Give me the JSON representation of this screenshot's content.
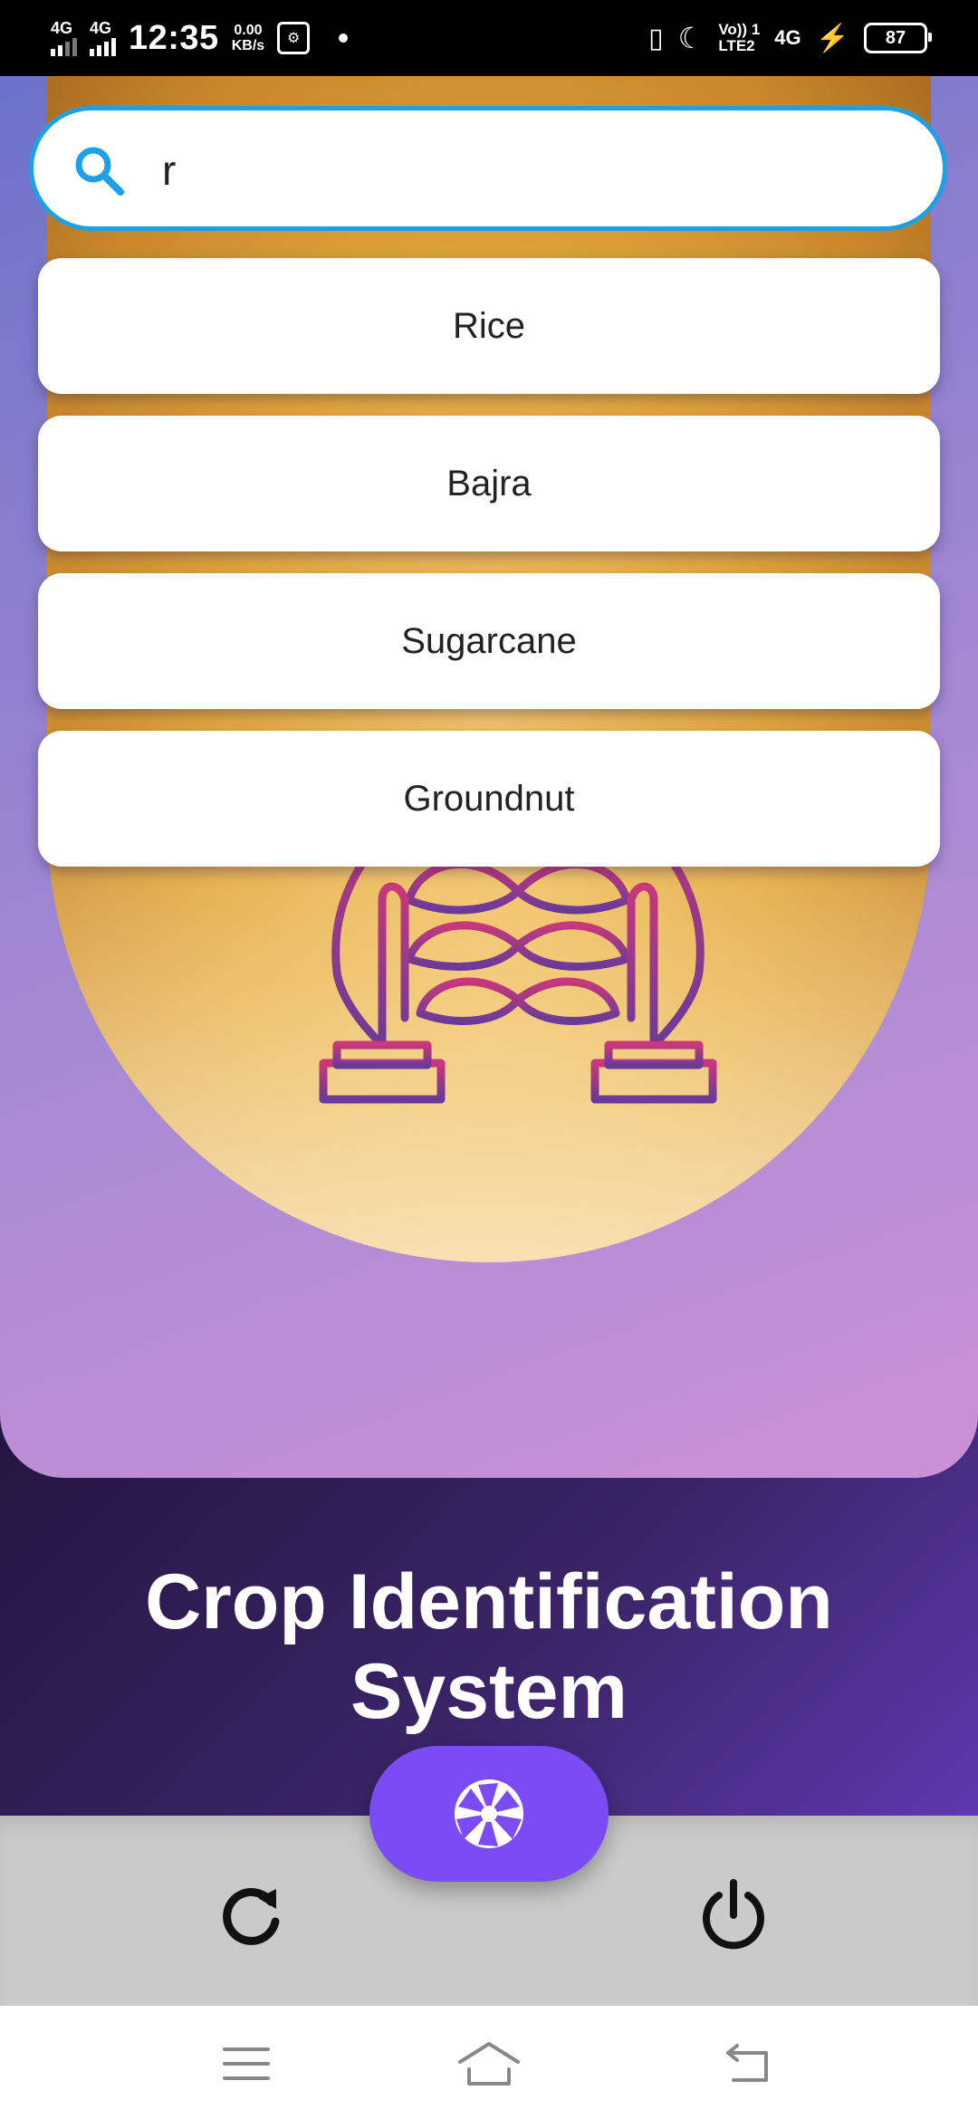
{
  "status_bar": {
    "signal1": "4G",
    "signal2": "4G",
    "time": "12:35",
    "speed_value": "0.00",
    "speed_unit": "KB/s",
    "volte_top": "Vo)) 1",
    "volte_bottom": "LTE2",
    "network": "4G",
    "battery": "87"
  },
  "search": {
    "value": "r",
    "placeholder": ""
  },
  "suggestions": [
    "Rice",
    "Bajra",
    "Sugarcane",
    "Groundnut"
  ],
  "app": {
    "title": "Crop Identification System"
  },
  "colors": {
    "accent": "#1da1e6",
    "fab": "#7b4cf4",
    "band_dark": "#231540"
  },
  "icons": {
    "search": "search-icon",
    "camera": "camera-aperture-icon",
    "refresh": "refresh-icon",
    "power": "power-icon"
  }
}
